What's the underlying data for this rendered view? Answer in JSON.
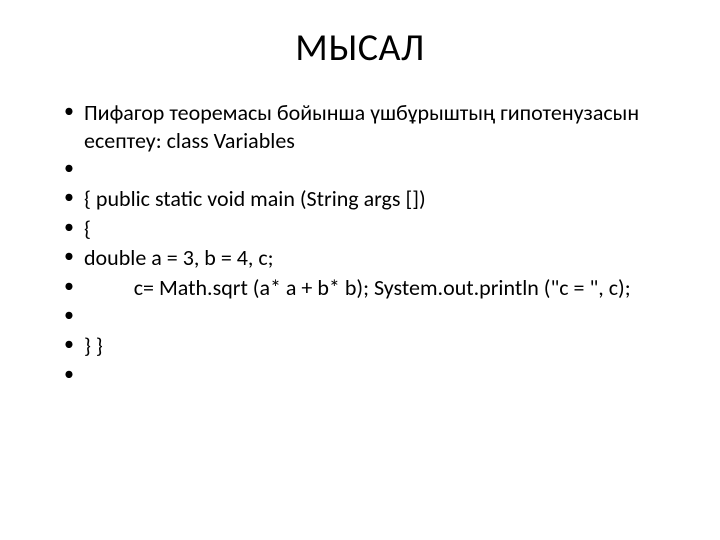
{
  "title": "МЫСАЛ",
  "bullets": {
    "b0": "Пифагор теоремасы бойынша үшбұрыштың гипотенузасын есептеу: class Variables",
    "b1": "",
    "b2": "{ public static void main (String args [])",
    "b3": "{",
    "b4": "double а = 3, b = 4, с;",
    "b5": "          с= Math.sqrt (а* а + b* b); System.out.println (\"c = \", с);",
    "b6": "",
    "b7": "} }",
    "b8": ""
  }
}
